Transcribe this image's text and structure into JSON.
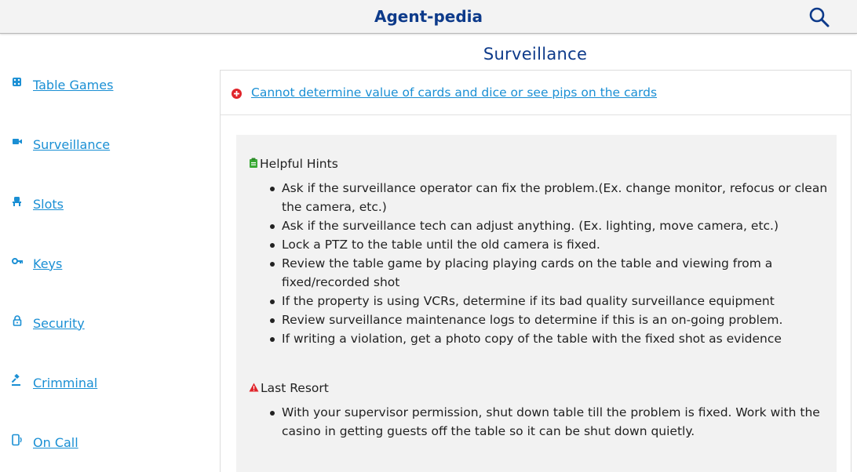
{
  "header": {
    "title": "Agent-pedia",
    "search_icon": "search-icon"
  },
  "sidebar": {
    "items": [
      {
        "label": "Table Games",
        "icon": "dice-icon"
      },
      {
        "label": "Surveillance",
        "icon": "video-camera-icon"
      },
      {
        "label": "Slots",
        "icon": "slot-chair-icon"
      },
      {
        "label": "Keys",
        "icon": "key-icon"
      },
      {
        "label": "Security",
        "icon": "lock-icon"
      },
      {
        "label": "Crimminal",
        "icon": "gavel-icon"
      },
      {
        "label": "On Call",
        "icon": "phone-icon"
      }
    ]
  },
  "main": {
    "title": "Surveillance",
    "issue": {
      "text": "Cannot determine value of cards and dice or see pips on the cards",
      "icon": "red-plus-circle-icon"
    },
    "helpful_hints": {
      "heading": "Helpful Hints",
      "icon": "clipboard-icon",
      "items": [
        "Ask if the surveillance operator can fix the problem.(Ex. change monitor, refocus or clean the camera, etc.)",
        "Ask if the surveillance tech can adjust anything. (Ex. lighting, move camera, etc.)",
        "Lock a PTZ to the table until the old camera is fixed.",
        "Review the table game by placing playing cards on the table and viewing from a fixed/recorded shot",
        "If the property is using VCRs, determine if its bad quality surveillance equipment",
        "Review surveillance maintenance logs to determine if this is an on-going problem.",
        "If writing a violation, get a photo copy of the table with the fixed shot as evidence"
      ]
    },
    "last_resort": {
      "heading": "Last Resort",
      "icon": "warning-triangle-icon",
      "items": [
        "With your supervisor permission, shut down table till the problem is fixed. Work with the casino in getting guests off the table so it can be shut down quietly."
      ]
    }
  },
  "colors": {
    "brand": "#0d3a8a",
    "link": "#1a8fd4",
    "danger": "#e0252b",
    "hint_icon": "#3aaa35"
  }
}
